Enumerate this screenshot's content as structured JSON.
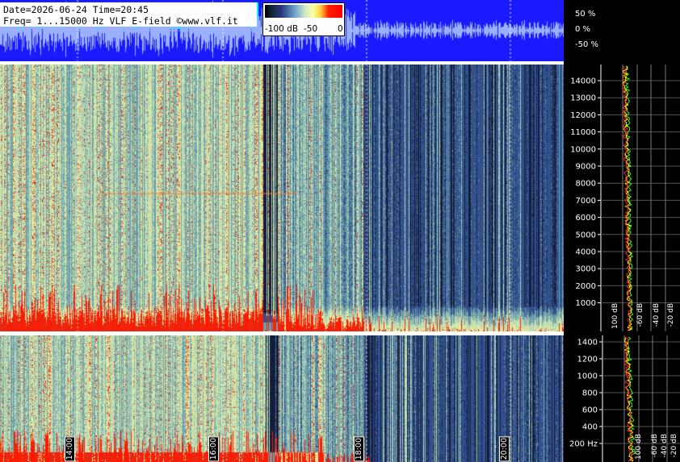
{
  "header": {
    "line1": "Date=2026-06-24 Time=20:45",
    "line2": "Freq= 1...15000 Hz   VLF E-field ©www.vlf.it"
  },
  "colorbar": {
    "labels": [
      "-100 dB",
      "-50",
      "0"
    ]
  },
  "amplitude_axis": [
    "50 %",
    "0 %",
    "-50 %"
  ],
  "freq_axis_top": [
    "14000",
    "13000",
    "12000",
    "11000",
    "10000",
    "9000",
    "8000",
    "7000",
    "6000",
    "5000",
    "4000",
    "3000",
    "2000",
    "1000"
  ],
  "freq_axis_bottom": [
    "1400",
    "1200",
    "1000",
    "800",
    "600",
    "400",
    "200 Hz"
  ],
  "time_labels": [
    "14:00",
    "16:00",
    "18:00",
    "20:00"
  ],
  "db_axis_top": [
    "100 dB",
    "-60 dB",
    "-40 dB",
    "-20 dB"
  ],
  "db_axis_bottom": [
    "100 dB",
    "-60 dB",
    "-40 dB",
    "-20 dB"
  ],
  "colors": {
    "wave_bg": "#1a1aff",
    "wave_info_bg": "#00ffff",
    "spec_base": "#3c5a80",
    "hot": "#ff0000"
  }
}
